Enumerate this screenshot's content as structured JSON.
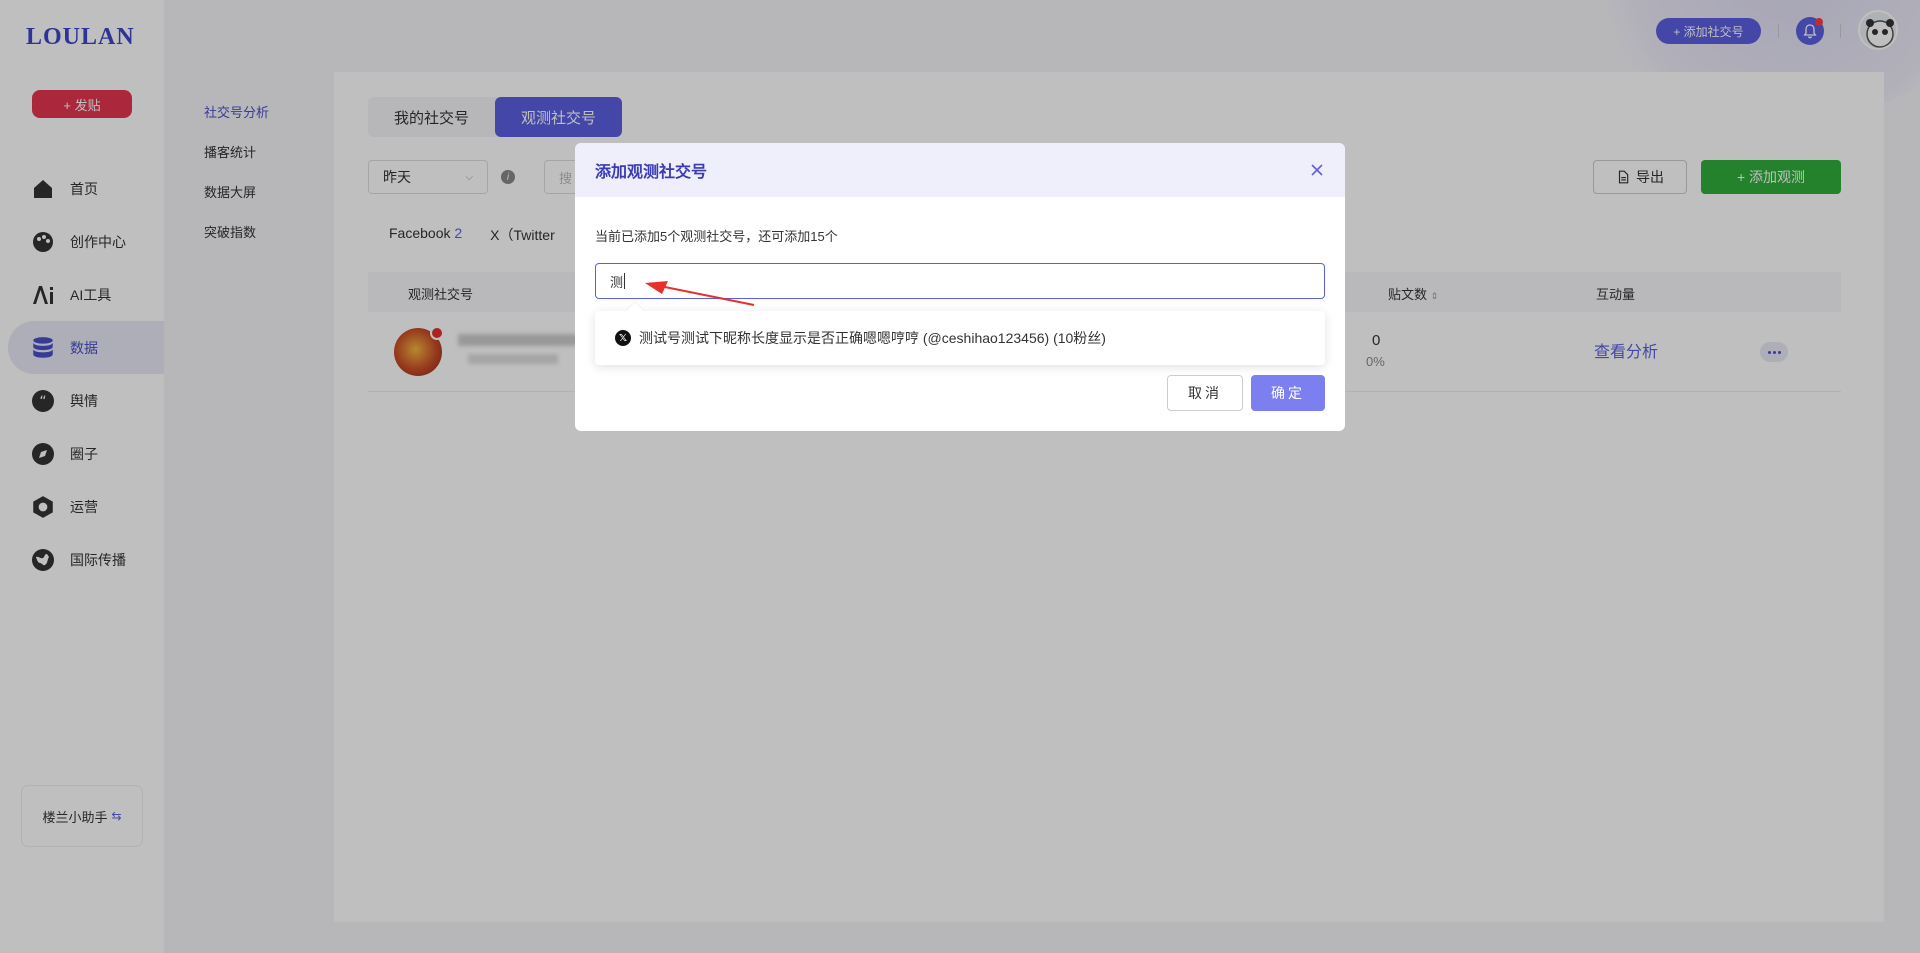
{
  "app": {
    "logo": "LOULAN"
  },
  "sidebar": {
    "post_button": "+ 发贴",
    "items": [
      {
        "label": "首页",
        "icon": "home-icon"
      },
      {
        "label": "创作中心",
        "icon": "palette-icon"
      },
      {
        "label": "AI工具",
        "icon": "ai-icon"
      },
      {
        "label": "数据",
        "icon": "database-icon",
        "active": true
      },
      {
        "label": "舆情",
        "icon": "quote-icon"
      },
      {
        "label": "圈子",
        "icon": "compass-icon"
      },
      {
        "label": "运营",
        "icon": "operation-icon"
      },
      {
        "label": "国际传播",
        "icon": "globe-icon"
      }
    ],
    "helper_label": "楼兰小助手"
  },
  "subnav": {
    "items": [
      {
        "label": "社交号分析",
        "active": true
      },
      {
        "label": "播客统计"
      },
      {
        "label": "数据大屏"
      },
      {
        "label": "突破指数"
      }
    ]
  },
  "topbar": {
    "add_account_label": "+ 添加社交号"
  },
  "main": {
    "tabs": [
      {
        "label": "我的社交号"
      },
      {
        "label": "观测社交号",
        "active": true
      }
    ],
    "date_select": "昨天",
    "search_placeholder": "搜",
    "export_label": "导出",
    "add_watch_label": "+ 添加观测",
    "platform_tabs": [
      {
        "label": "Facebook",
        "count": "2"
      },
      {
        "label": "X（Twitter",
        "count": ""
      }
    ],
    "table": {
      "headers": {
        "account": "观测社交号",
        "posts": "贴文数",
        "engagement": "互动量"
      },
      "rows": [
        {
          "posts": "0",
          "posts_pct": "0%",
          "action": "查看分析"
        }
      ]
    }
  },
  "modal": {
    "title": "添加观测社交号",
    "note": "当前已添加5个观测社交号，还可添加15个",
    "input_value": "测",
    "suggestion": "测试号测试下昵称长度显示是否正确嗯嗯哼哼 (@ceshihao123456) (10粉丝)",
    "cancel_label": "取消",
    "ok_label": "确定"
  },
  "colors": {
    "brand": "#5b5fe0",
    "danger": "#e53550",
    "success": "#2fae3a",
    "annotation": "#e8302a"
  }
}
